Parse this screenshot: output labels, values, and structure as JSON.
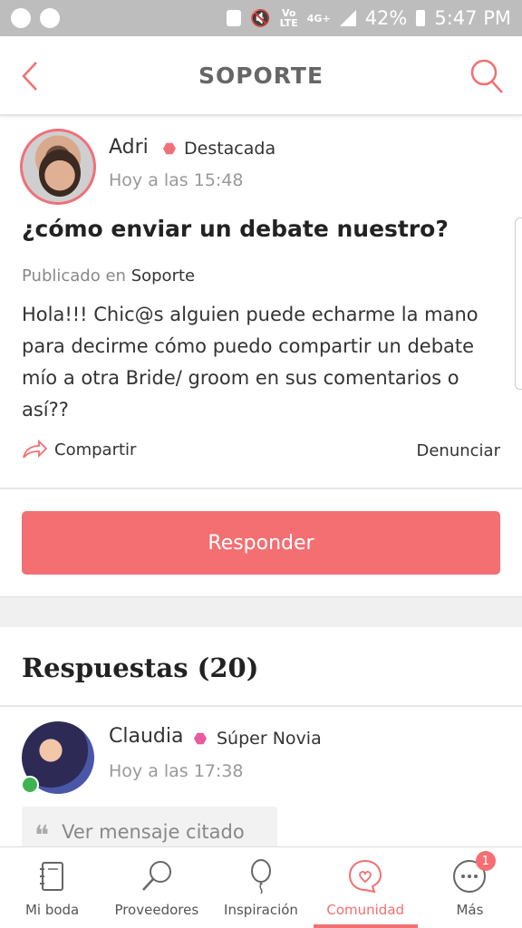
{
  "status_bar": {
    "network_top": "Vo",
    "network_bottom": "LTE",
    "data_top": "4G+",
    "battery": "42%",
    "time": "5:47 PM"
  },
  "header": {
    "title": "SOPORTE"
  },
  "post": {
    "author": "Adri",
    "badge": "Destacada",
    "time": "Hoy a las 15:48",
    "title": "¿cómo enviar un debate nuestro?",
    "published_prefix": "Publicado en",
    "published_in": "Soporte",
    "body": "Hola!!! Chic@s alguien puede echarme la mano para decirme cómo puedo compartir un debate mío a otra Bride/ groom en sus comentarios o así??",
    "share_label": "Compartir",
    "report_label": "Denunciar"
  },
  "reply_button": "Responder",
  "answers": {
    "title": "Respuestas (20)",
    "items": [
      {
        "author": "Claudia",
        "badge": "Súper Novia",
        "time": "Hoy a las 17:38",
        "quote_label": "Ver mensaje citado"
      }
    ]
  },
  "bottom_nav": {
    "items": [
      {
        "label": "Mi boda",
        "icon": "notebook-icon"
      },
      {
        "label": "Proveedores",
        "icon": "search-icon"
      },
      {
        "label": "Inspiración",
        "icon": "balloon-icon"
      },
      {
        "label": "Comunidad",
        "icon": "heart-bubble-icon",
        "active": true
      },
      {
        "label": "Más",
        "icon": "more-icon",
        "badge": "1"
      }
    ]
  },
  "colors": {
    "accent": "#f36f72",
    "status_bar": "#bdbdbd",
    "online": "#3fb34f"
  }
}
